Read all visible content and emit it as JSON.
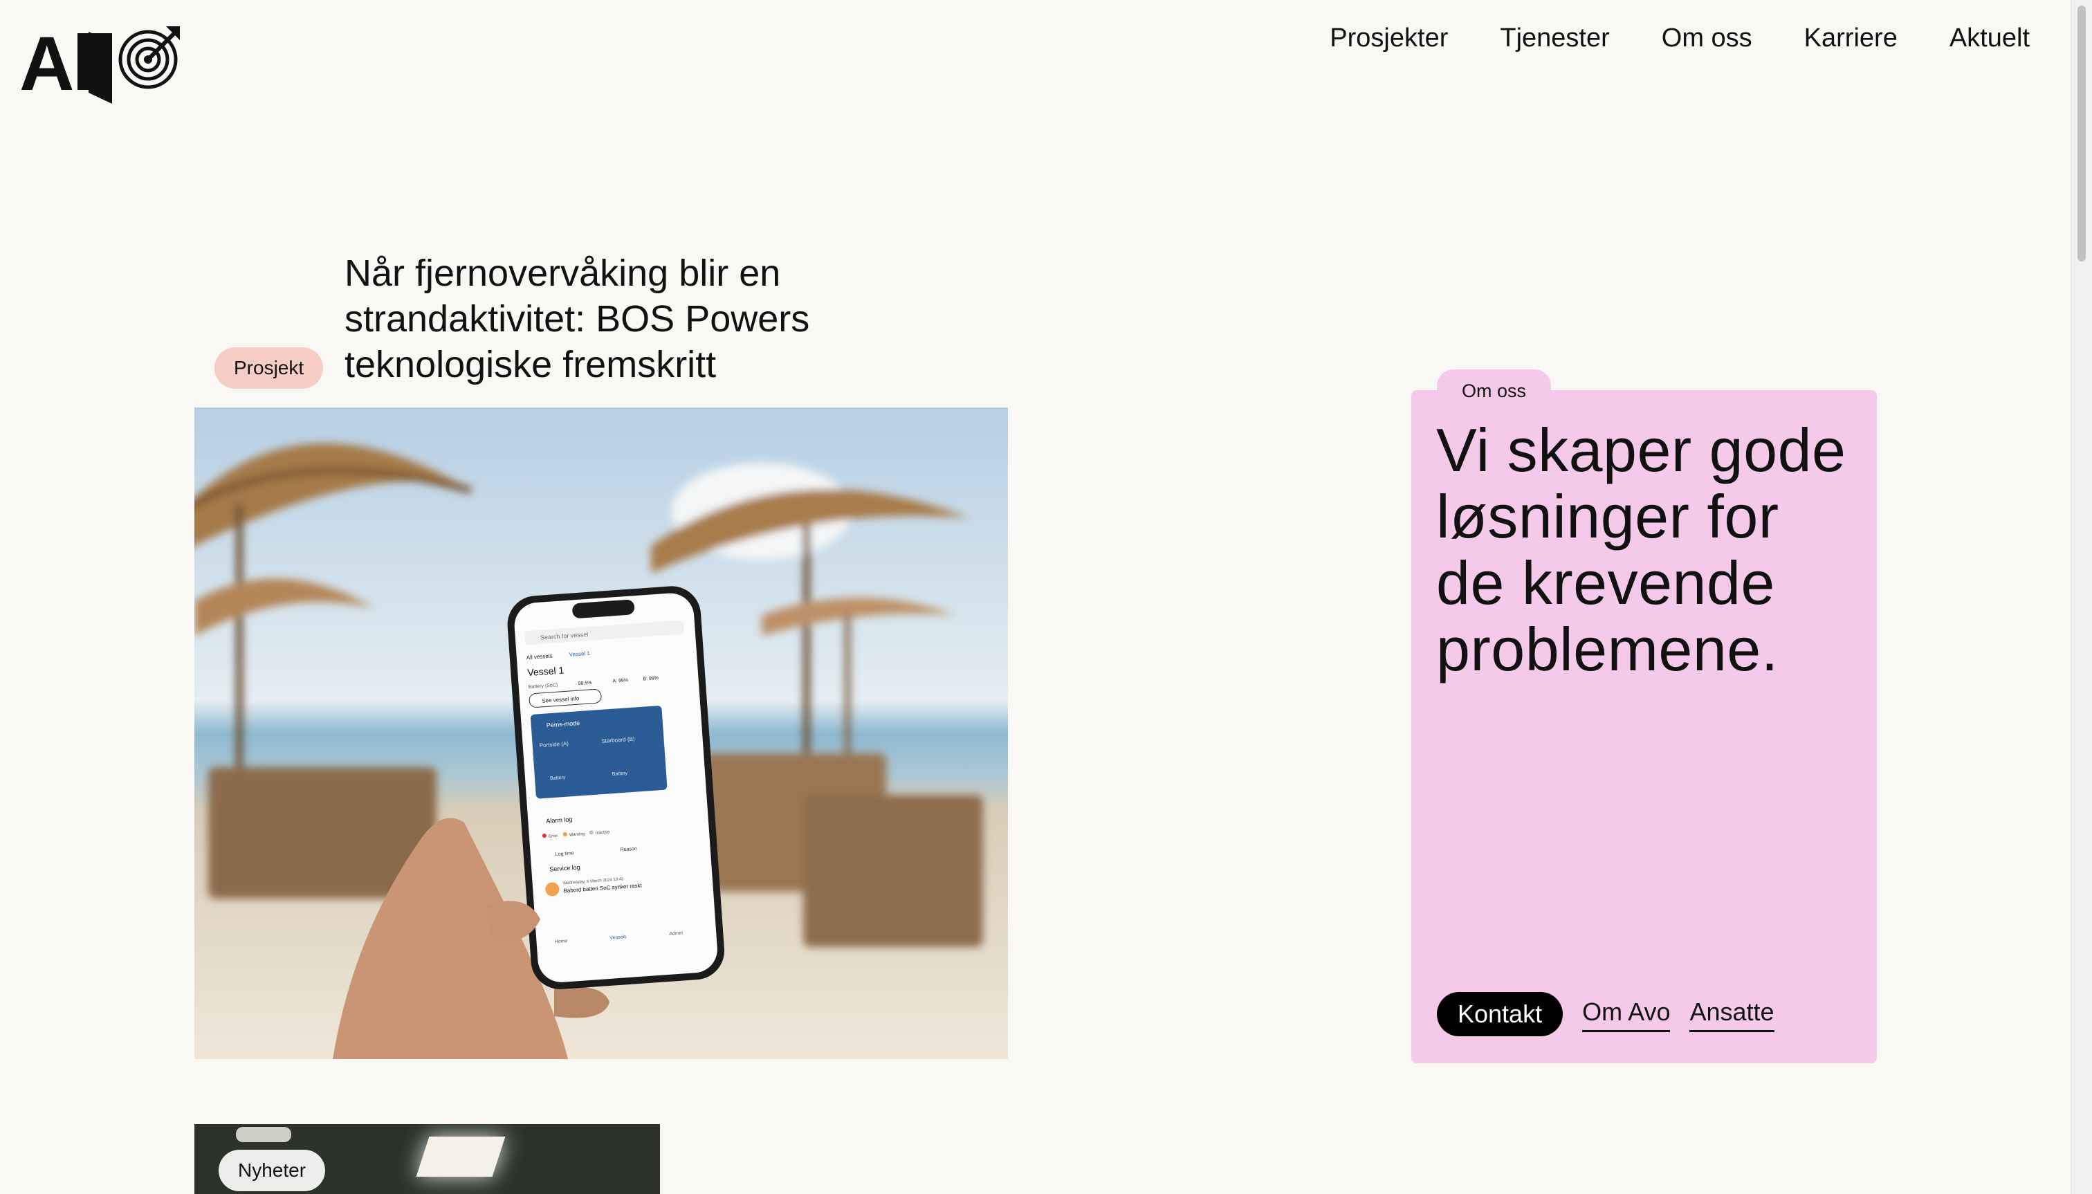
{
  "brand": {
    "name": "AVO"
  },
  "nav": {
    "items": [
      "Prosjekter",
      "Tjenester",
      "Om oss",
      "Karriere",
      "Aktuelt"
    ]
  },
  "article": {
    "tag": "Prosjekt",
    "title": "Når fjernovervåking blir en strandaktivitet: BOS Powers teknologiske fremskritt",
    "phone": {
      "search_placeholder": "Search for vessel",
      "crumb_all": "All vessels",
      "crumb_vessel": "Vessel 1",
      "vessel": "Vessel 1",
      "battery": "Battery (SoC)",
      "battery_val": "98.5%",
      "a_val": "A: 98%",
      "b_val": "B: 99%",
      "see_info": "See vessel info",
      "mode": "Pems-mode",
      "port": "Portside (A)",
      "star": "Starboard (B)",
      "battery_btn": "Battery",
      "alarm": "Alarm log",
      "legend": [
        "Error",
        "Warning",
        "Inactive"
      ],
      "log_time": "Log time",
      "reason": "Reason",
      "service": "Service log",
      "entry_date": "Wednesday, 6 March 2024 19:43",
      "entry_text": "Babord batteri SoC synker raskt",
      "tabs": [
        "Home",
        "Vessels",
        "Admin"
      ]
    }
  },
  "news": {
    "tag": "Nyheter"
  },
  "about": {
    "tab": "Om oss",
    "heading": "Vi skaper gode løsninger for de krevende problemene.",
    "kontakt": "Kontakt",
    "links": [
      "Om Avo",
      "Ansatte"
    ]
  },
  "colors": {
    "background": "#f9f8f5",
    "about_card": "#f5c9e9",
    "tag_prosjekt": "#f6cdc4"
  }
}
